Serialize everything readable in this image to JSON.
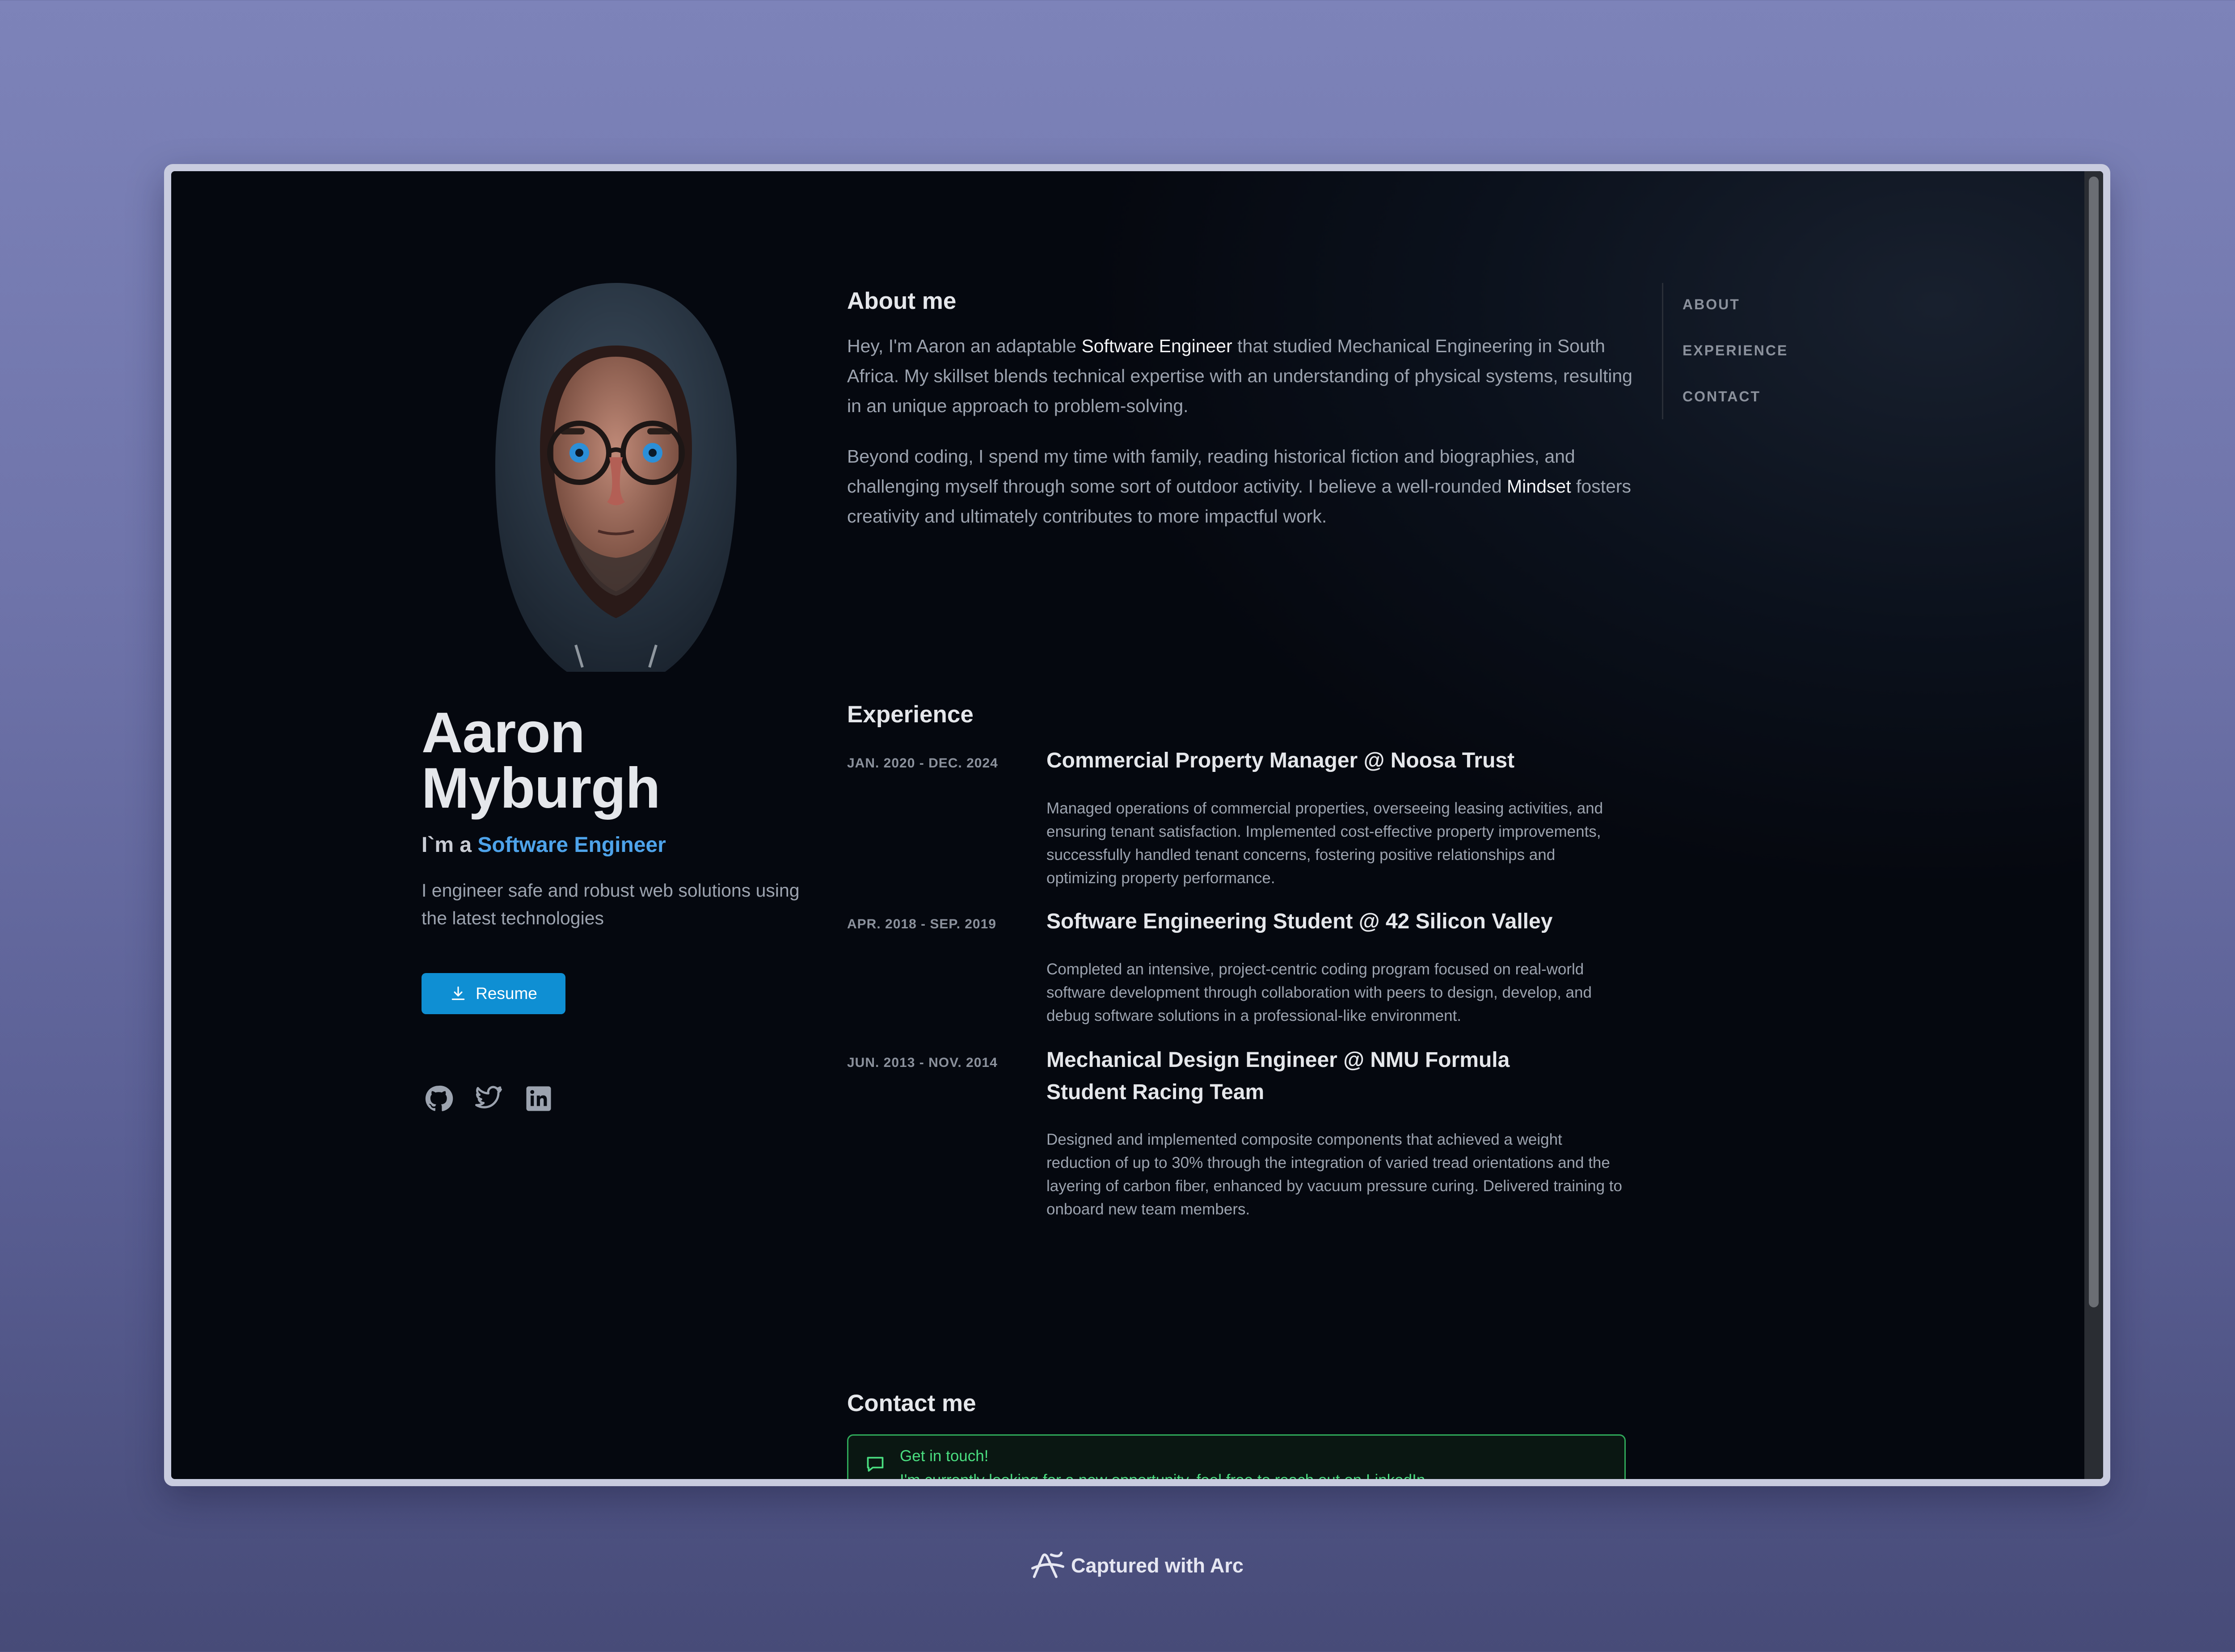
{
  "profile": {
    "first_name": "Aaron",
    "last_name": "Myburgh",
    "role_prefix": "I`m a",
    "role": "Software Engineer",
    "tagline": "I engineer safe and robust web solutions using the latest technologies",
    "resume_label": "Resume",
    "social_icons": [
      "github-icon",
      "twitter-icon",
      "linkedin-icon"
    ]
  },
  "nav": {
    "items": [
      "ABOUT",
      "EXPERIENCE",
      "CONTACT"
    ]
  },
  "about": {
    "title": "About me",
    "p1_before": "Hey, I'm Aaron an adaptable ",
    "p1_highlight": "Software Engineer",
    "p1_after": " that studied Mechanical Engineering in South Africa. My skillset blends technical expertise with an understanding of physical systems, resulting in an unique approach to problem-solving.",
    "p2_before": "Beyond coding, I spend my time with family, reading historical fiction and biographies, and challenging myself through some sort of outdoor activity. I believe a well-rounded ",
    "p2_highlight": "Mindset",
    "p2_after": " fosters creativity and ultimately contributes to more impactful work."
  },
  "experience": {
    "title": "Experience",
    "items": [
      {
        "dates": "JAN. 2020 - DEC. 2024",
        "title": "Commercial Property Manager @ Noosa Trust",
        "desc": "Managed operations of commercial properties, overseeing leasing activities, and ensuring tenant satisfaction. Implemented cost-effective property improvements, successfully handled tenant concerns, fostering positive relationships and optimizing property performance."
      },
      {
        "dates": "APR. 2018 - SEP. 2019",
        "title": "Software Engineering Student @ 42 Silicon Valley",
        "desc": "Completed an intensive, project-centric coding program focused on real-world software development through collaboration with peers to design, develop, and debug software solutions in a professional-like environment."
      },
      {
        "dates": "JUN. 2013 - NOV. 2014",
        "title": "Mechanical Design Engineer @ NMU Formula Student Racing Team",
        "desc": "Designed and implemented composite components that achieved a weight reduction of up to 30% through the integration of varied tread orientations and the layering of carbon fiber, enhanced by vacuum pressure curing. Delivered training to onboard new team members."
      }
    ]
  },
  "contact": {
    "title": "Contact me",
    "card_title": "Get in touch!",
    "card_message": "I'm currently looking for a new opportunity, feel free to reach out on LinkedIn"
  },
  "footer": {
    "label": "Captured with Arc"
  }
}
